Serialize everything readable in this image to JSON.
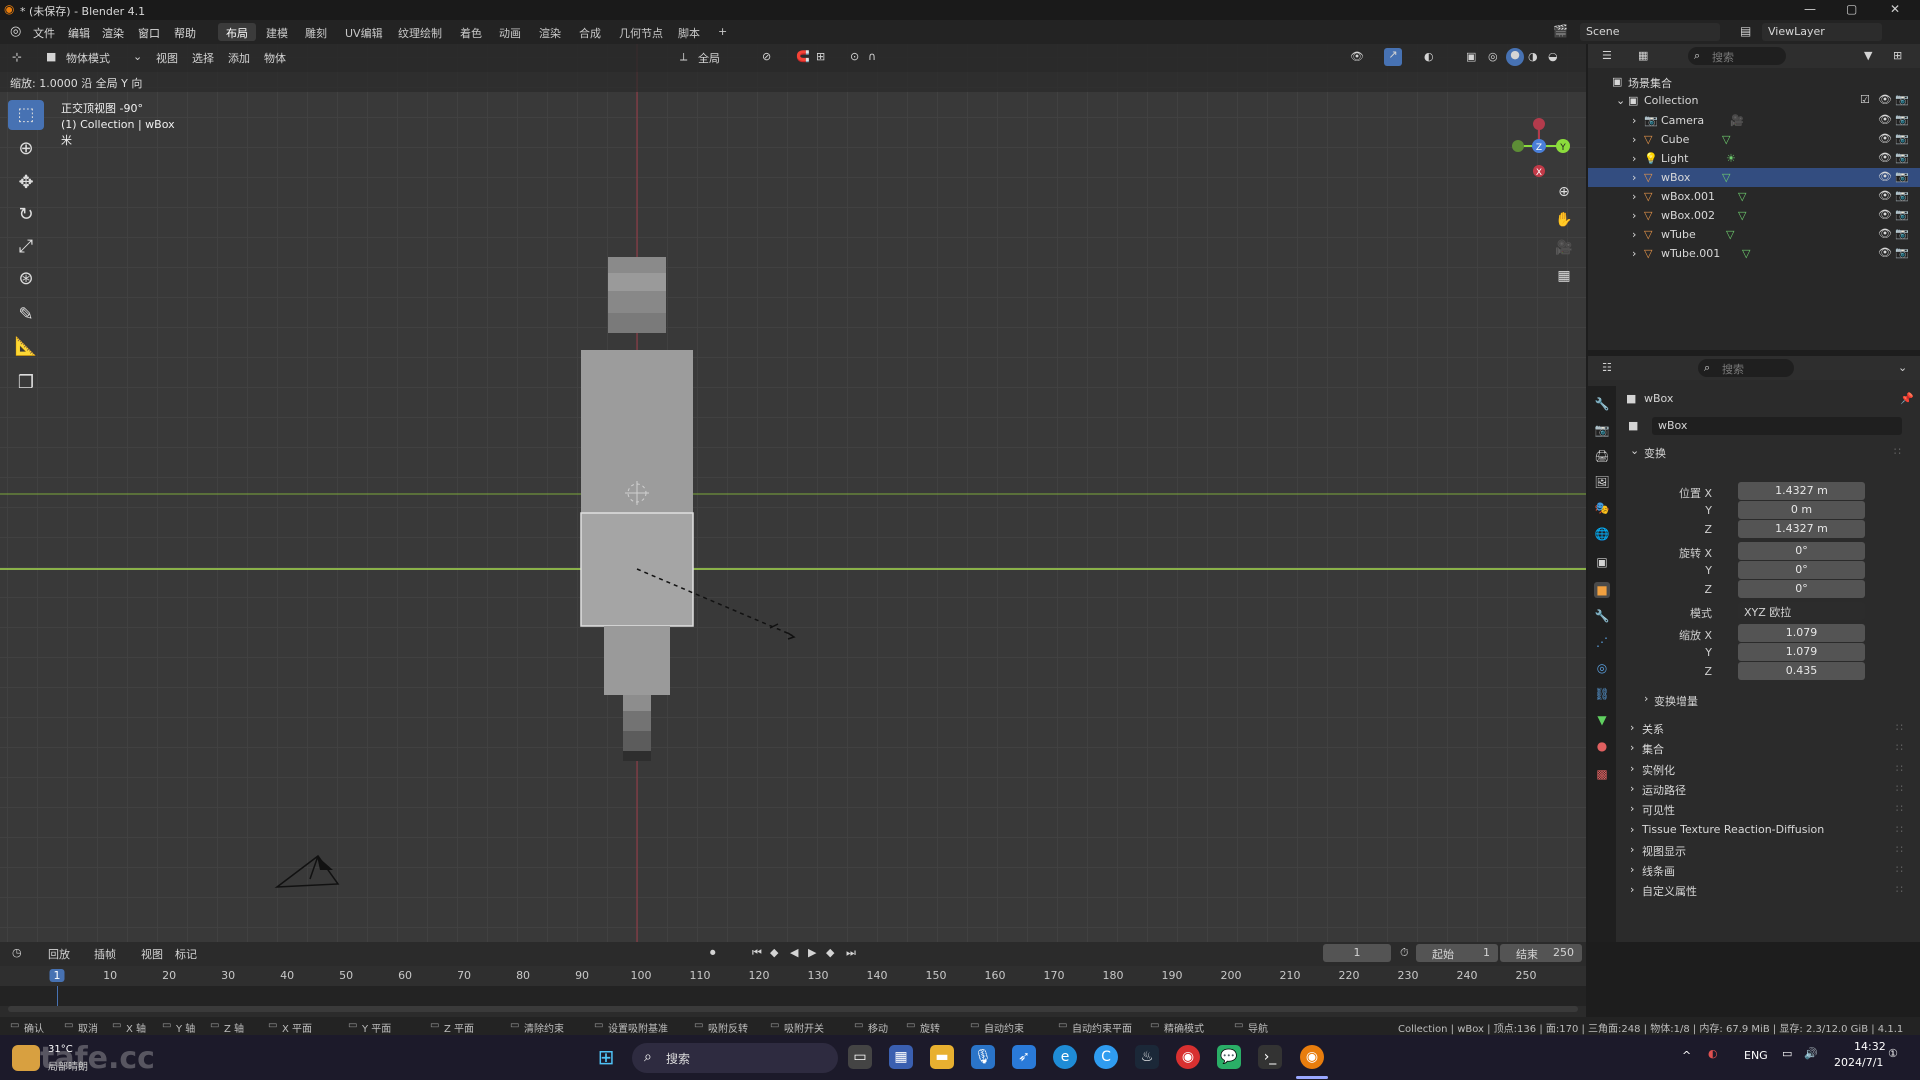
{
  "window": {
    "title": "* (未保存) - Blender 4.1"
  },
  "menu": {
    "items": [
      "文件",
      "编辑",
      "渲染",
      "窗口",
      "帮助"
    ]
  },
  "workspaces": [
    "布局",
    "建模",
    "雕刻",
    "UV编辑",
    "纹理绘制",
    "着色",
    "动画",
    "渲染",
    "合成",
    "几何节点",
    "脚本"
  ],
  "workspace_add": "+",
  "scene": {
    "label": "Scene",
    "view_layer": "ViewLayer"
  },
  "viewport": {
    "mode": "物体模式",
    "menus": [
      "视图",
      "选择",
      "添加",
      "物体"
    ],
    "transform_orientation": "全局",
    "status_line": "缩放: 1.0000 沿 全局 Y 向",
    "overlay_lines": [
      "正交顶视图 -90°",
      "(1) Collection | wBox",
      "米"
    ],
    "gizmo": {
      "x": "X",
      "y": "Y",
      "z": "Z"
    }
  },
  "outliner": {
    "search_placeholder": "搜索",
    "root": "场景集合",
    "collection": "Collection",
    "items": [
      {
        "name": "Camera",
        "selected": false
      },
      {
        "name": "Cube",
        "selected": false
      },
      {
        "name": "Light",
        "selected": false
      },
      {
        "name": "wBox",
        "selected": true
      },
      {
        "name": "wBox.001",
        "selected": false
      },
      {
        "name": "wBox.002",
        "selected": false
      },
      {
        "name": "wTube",
        "selected": false
      },
      {
        "name": "wTube.001",
        "selected": false
      }
    ]
  },
  "properties": {
    "search_placeholder": "搜索",
    "object_name": "wBox",
    "object_field": "wBox",
    "transform_header": "变换",
    "location_label": "位置 X",
    "location": [
      "1.4327 m",
      "0 m",
      "1.4327 m"
    ],
    "rotation_label": "旋转 X",
    "rotation": [
      "0°",
      "0°",
      "0°"
    ],
    "mode_label": "模式",
    "mode_value": "XYZ 欧拉",
    "scale_label": "缩放 X",
    "scale": [
      "1.079",
      "1.079",
      "0.435"
    ],
    "axis_y": "Y",
    "axis_z": "Z",
    "delta_transform": "变换增量",
    "panels": [
      "关系",
      "集合",
      "实例化",
      "运动路径",
      "可见性",
      "Tissue Texture Reaction-Diffusion",
      "视图显示",
      "线条画",
      "自定义属性"
    ]
  },
  "timeline": {
    "menus": [
      "回放",
      "插帧",
      "视图",
      "标记"
    ],
    "current_frame": "1",
    "start_label": "起始",
    "start": "1",
    "end_label": "结束",
    "end": "250",
    "ticks": [
      "1",
      "10",
      "20",
      "30",
      "40",
      "50",
      "60",
      "70",
      "80",
      "90",
      "100",
      "110",
      "120",
      "130",
      "140",
      "150",
      "160",
      "170",
      "180",
      "190",
      "200",
      "210",
      "220",
      "230",
      "240",
      "250"
    ]
  },
  "statusbar": {
    "hints": [
      "确认",
      "取消",
      "X 轴",
      "Y 轴",
      "Z 轴",
      "X 平面",
      "Y 平面",
      "Z 平面",
      "清除约束",
      "设置吸附基准",
      "吸附反转",
      "吸附开关",
      "移动",
      "旋转",
      "自动约束",
      "自动约束平面",
      "精确模式",
      "导航"
    ],
    "stats": "Collection | wBox | 顶点:136 | 面:170 | 三角面:248 | 物体:1/8 | 内存: 67.9 MiB | 显存: 2.3/12.0 GiB | 4.1.1"
  },
  "taskbar": {
    "weather_temp": "31°C",
    "weather_desc": "局部晴朗",
    "search": "搜索",
    "lang": "ENG",
    "time": "14:32",
    "date": "2024/7/1",
    "watermark": "tafe.cc"
  },
  "colors": {
    "accent": "#4772b3",
    "selected_row": "#334d80",
    "x_axis": "#b33b4c",
    "y_axis": "#8bdc3c",
    "taskbar": "#1c1a2a"
  }
}
